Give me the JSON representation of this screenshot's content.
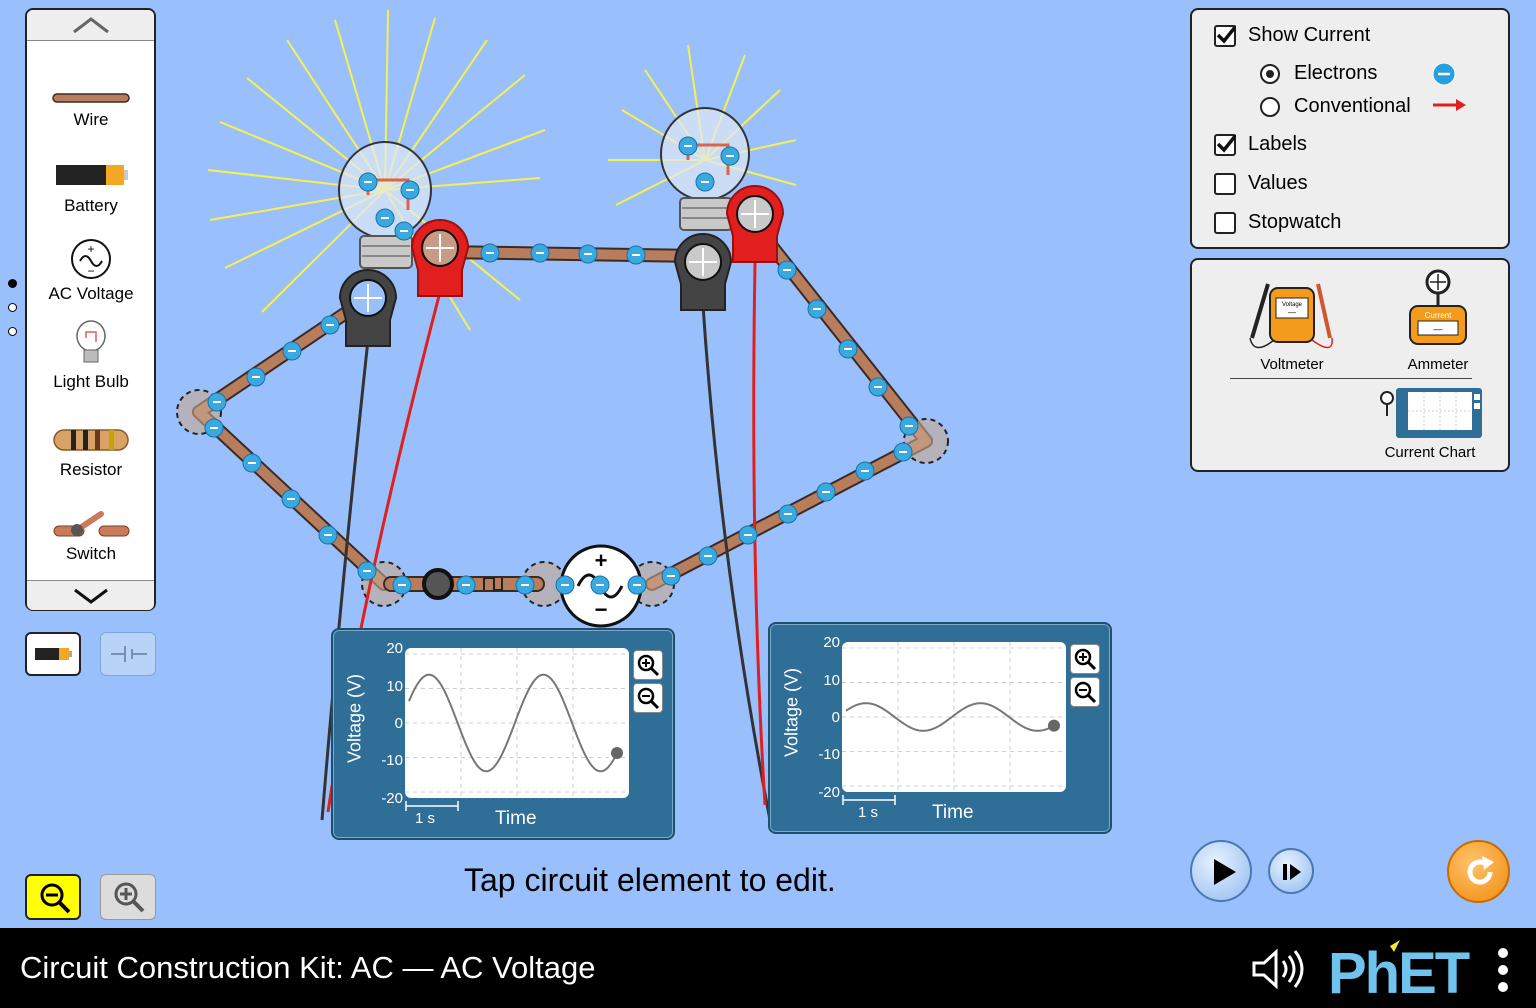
{
  "title": "Circuit Construction Kit: AC — AC Voltage",
  "carousel": {
    "items": [
      {
        "label": "Wire",
        "icon": "wire-icon"
      },
      {
        "label": "Battery",
        "icon": "battery-icon"
      },
      {
        "label": "AC Voltage",
        "icon": "ac-voltage-icon"
      },
      {
        "label": "Light Bulb",
        "icon": "light-bulb-icon"
      },
      {
        "label": "Resistor",
        "icon": "resistor-icon"
      },
      {
        "label": "Switch",
        "icon": "switch-icon"
      }
    ],
    "page_count": 3,
    "current_page": 1
  },
  "controls": {
    "show_current": {
      "label": "Show Current",
      "checked": true
    },
    "electrons": {
      "label": "Electrons",
      "selected": true
    },
    "conventional": {
      "label": "Conventional",
      "selected": false
    },
    "labels": {
      "label": "Labels",
      "checked": true
    },
    "values": {
      "label": "Values",
      "checked": false
    },
    "stopwatch": {
      "label": "Stopwatch",
      "checked": false
    }
  },
  "toolbox": {
    "voltmeter_label": "Voltmeter",
    "ammeter_label": "Ammeter",
    "current_chart_label": "Current Chart",
    "voltmeter_screen": "Voltage",
    "ammeter_screen": "Current",
    "voltmeter_reading": "—",
    "ammeter_reading": "—"
  },
  "hint": "Tap circuit element to edit.",
  "colors": {
    "background": "#99c0fc",
    "chart_panel": "#2e6e97",
    "positive_probe": "#e21f1f",
    "negative_probe": "#333333",
    "electron": "#3aa9e0",
    "wire": "#b87d5d"
  },
  "chart_data": [
    {
      "type": "line",
      "ylabel": "Voltage (V)",
      "xlabel": "Time",
      "time_scale_label": "1 s",
      "ylim": [
        -20,
        20
      ],
      "yticks": [
        20,
        10,
        0,
        -10,
        -20
      ],
      "series": [
        {
          "amplitude": 14,
          "period": 2.2,
          "phase_offset": 1.1
        }
      ]
    },
    {
      "type": "line",
      "ylabel": "Voltage (V)",
      "xlabel": "Time",
      "time_scale_label": "1 s",
      "ylim": [
        -20,
        20
      ],
      "yticks": [
        20,
        10,
        0,
        -10,
        -20
      ],
      "series": [
        {
          "amplitude": 4,
          "period": 2.2,
          "phase_offset": 1.1
        }
      ]
    }
  ]
}
